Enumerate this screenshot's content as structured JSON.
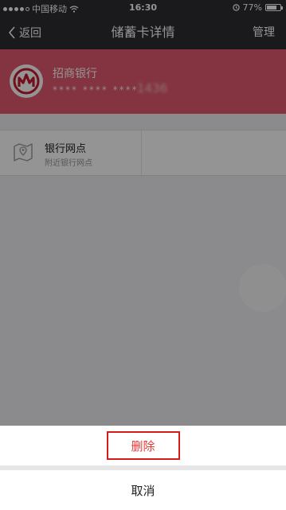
{
  "status_bar": {
    "carrier": "中国移动",
    "time": "16:30",
    "battery_percent": "77%",
    "battery_level": 0.77
  },
  "nav": {
    "back_label": "返回",
    "title": "储蓄卡详情",
    "manage_label": "管理"
  },
  "card": {
    "bank_name": "招商银行",
    "masked_number": "**** **** ****",
    "tail": "1436",
    "color": "#e35b6f"
  },
  "branch": {
    "title": "银行网点",
    "subtitle": "附近银行网点",
    "icon": "map-icon"
  },
  "action_sheet": {
    "delete_label": "删除",
    "cancel_label": "取消",
    "delete_color": "#e53935"
  }
}
